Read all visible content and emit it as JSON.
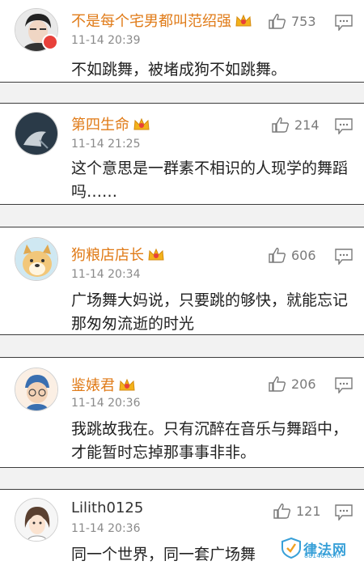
{
  "comments": [
    {
      "username": "不是每个宅男都叫范绍强",
      "time": "11-14 20:39",
      "likes": "753",
      "content": "不如跳舞，被堵成狗不如跳舞。"
    },
    {
      "username": "第四生命",
      "time": "11-14 21:25",
      "likes": "214",
      "content": "这个意思是一群素不相识的人现学的舞蹈吗……"
    },
    {
      "username": "狗粮店店长",
      "time": "11-14 20:34",
      "likes": "606",
      "content": "广场舞大妈说，只要跳的够快，就能忘记那匆匆流逝的时光"
    },
    {
      "username": "鉴婊君",
      "time": "11-14 20:36",
      "likes": "206",
      "content": "我跳故我在。只有沉醉在音乐与舞蹈中，才能暂时忘掉那事事非非。"
    },
    {
      "username": "Lilith0125",
      "time": "11-14 20:36",
      "likes": "121",
      "content": "同一个世界，同一套广场舞"
    }
  ],
  "watermark": {
    "text": "律法网",
    "url": "88148.com"
  },
  "colors": {
    "vip_name": "#e07b18",
    "plain_name": "#333333",
    "time": "#8a8a8a",
    "divider": "#3c3c3c"
  }
}
